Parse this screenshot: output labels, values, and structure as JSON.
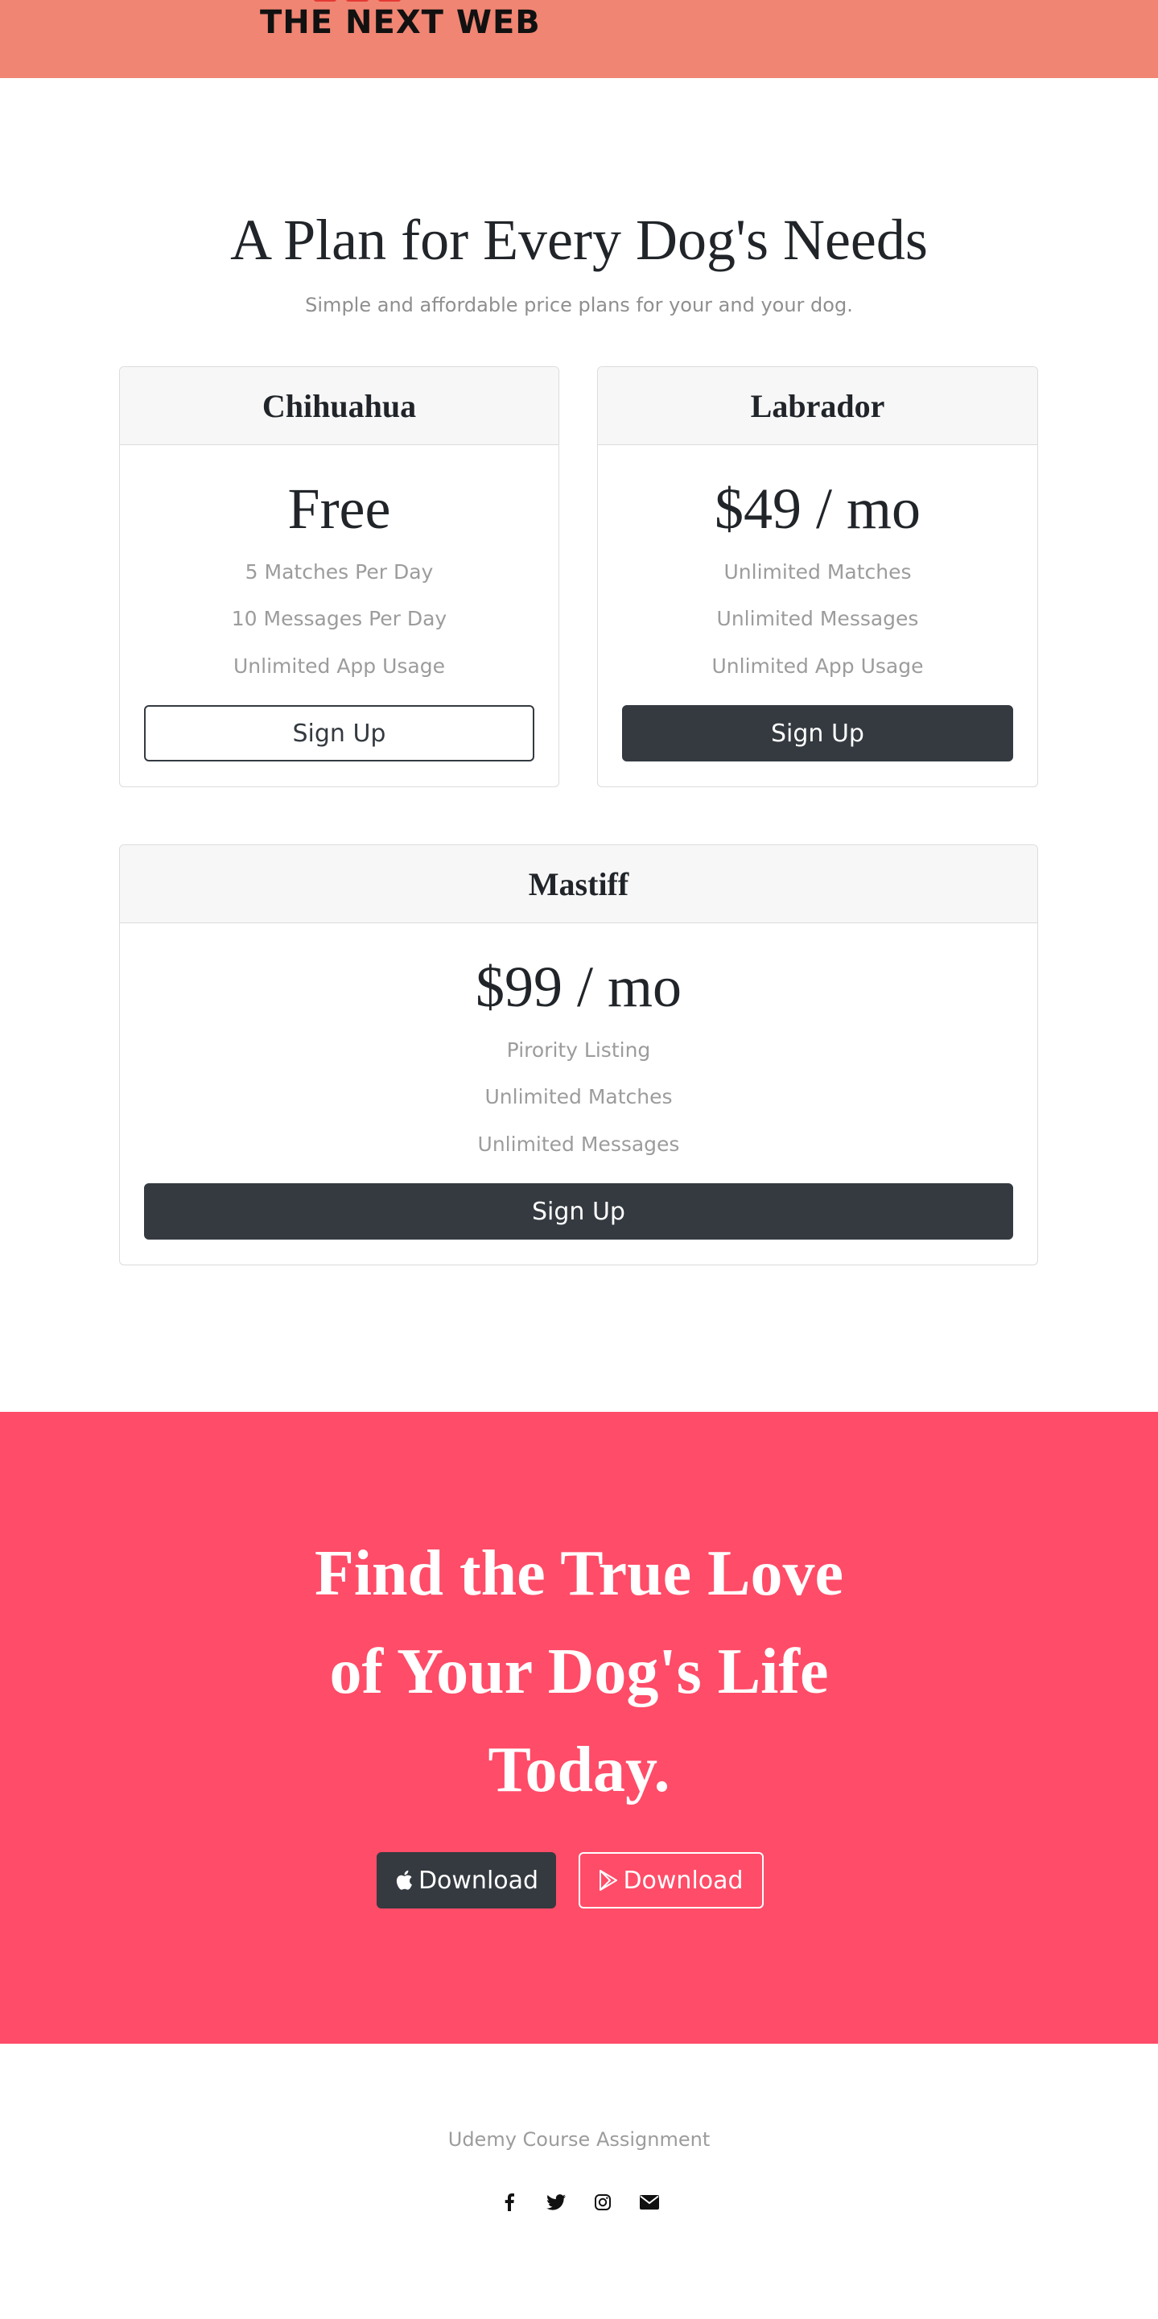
{
  "header": {
    "logo_text": "THE NEXT WEB"
  },
  "pricing": {
    "title": "A Plan for Every Dog's Needs",
    "subtitle": "Simple and affordable price plans for your and your dog.",
    "plans": [
      {
        "name": "Chihuahua",
        "price": "Free",
        "features": [
          "5 Matches Per Day",
          "10 Messages Per Day",
          "Unlimited App Usage"
        ],
        "button": "Sign Up",
        "button_style": "outline"
      },
      {
        "name": "Labrador",
        "price": "$49 / mo",
        "features": [
          "Unlimited Matches",
          "Unlimited Messages",
          "Unlimited App Usage"
        ],
        "button": "Sign Up",
        "button_style": "dark"
      },
      {
        "name": "Mastiff",
        "price": "$99 / mo",
        "features": [
          "Pirority Listing",
          "Unlimited Matches",
          "Unlimited Messages"
        ],
        "button": "Sign Up",
        "button_style": "dark"
      }
    ]
  },
  "cta": {
    "title_lines": [
      "Find the True Love",
      "of Your Dog's Life",
      "Today."
    ],
    "buttons": [
      {
        "label": "Download",
        "icon": "apple-icon"
      },
      {
        "label": "Download",
        "icon": "google-play-icon"
      }
    ]
  },
  "footer": {
    "text": "Udemy Course Assignment",
    "socials": [
      "facebook-icon",
      "twitter-icon",
      "instagram-icon",
      "envelope-icon"
    ]
  },
  "colors": {
    "header_bg": "#f08573",
    "cta_bg": "#ff4c68",
    "dark_button": "#343a40",
    "muted_text": "#9c9c9c"
  }
}
